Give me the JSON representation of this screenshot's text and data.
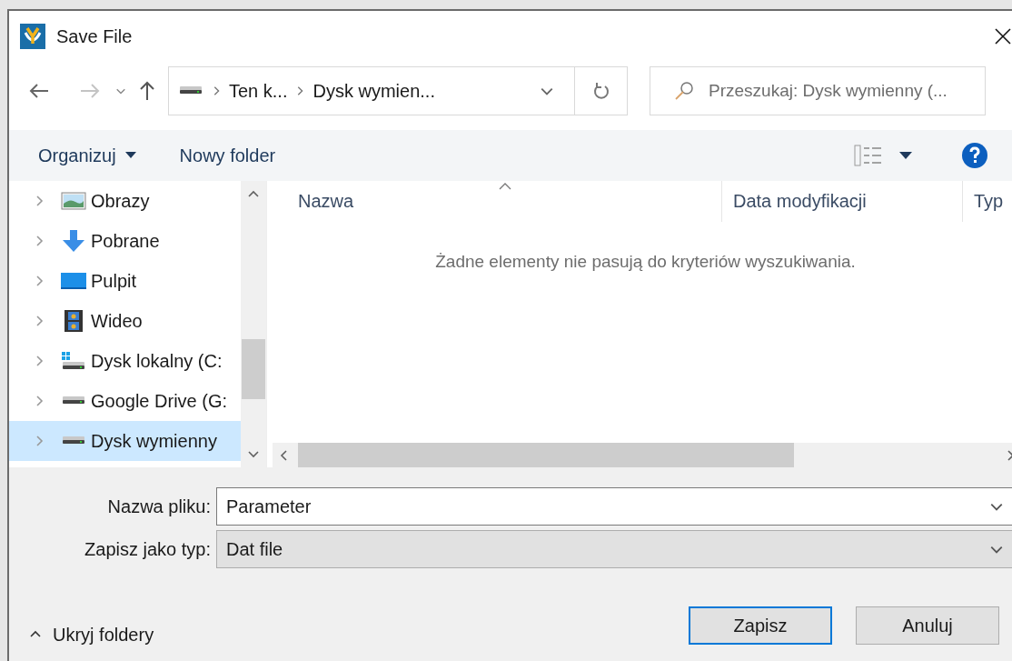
{
  "window": {
    "title": "Save File"
  },
  "navigation": {
    "breadcrumbs": [
      "Ten k...",
      "Dysk wymien..."
    ],
    "search": {
      "placeholder": "Przeszukaj: Dysk wymienny (..."
    }
  },
  "toolbar": {
    "organize": "Organizuj",
    "new_folder": "Nowy folder"
  },
  "sidebar": {
    "items": [
      {
        "label": "Obrazy",
        "kind": "pictures",
        "selected": false
      },
      {
        "label": "Pobrane",
        "kind": "downloads",
        "selected": false
      },
      {
        "label": "Pulpit",
        "kind": "desktop",
        "selected": false
      },
      {
        "label": "Wideo",
        "kind": "videos",
        "selected": false
      },
      {
        "label": "Dysk lokalny (C:",
        "kind": "system-drive",
        "selected": false
      },
      {
        "label": "Google Drive (G:",
        "kind": "drive",
        "selected": false
      },
      {
        "label": "Dysk wymienny",
        "kind": "drive",
        "selected": true
      }
    ]
  },
  "file_list": {
    "columns": [
      {
        "label": "Nazwa",
        "sorted": true
      },
      {
        "label": "Data modyfikacji",
        "sorted": false
      },
      {
        "label": "Typ",
        "sorted": false
      }
    ],
    "empty_message": "Żadne elementy nie pasują do kryteriów wyszukiwania."
  },
  "file_name": {
    "label": "Nazwa pliku:",
    "value": "Parameter"
  },
  "file_type": {
    "label": "Zapisz jako typ:",
    "value": "Dat file"
  },
  "hide_folders": "Ukryj foldery",
  "buttons": [
    {
      "label": "Zapisz",
      "default": true
    },
    {
      "label": "Anuluj",
      "default": false
    }
  ]
}
